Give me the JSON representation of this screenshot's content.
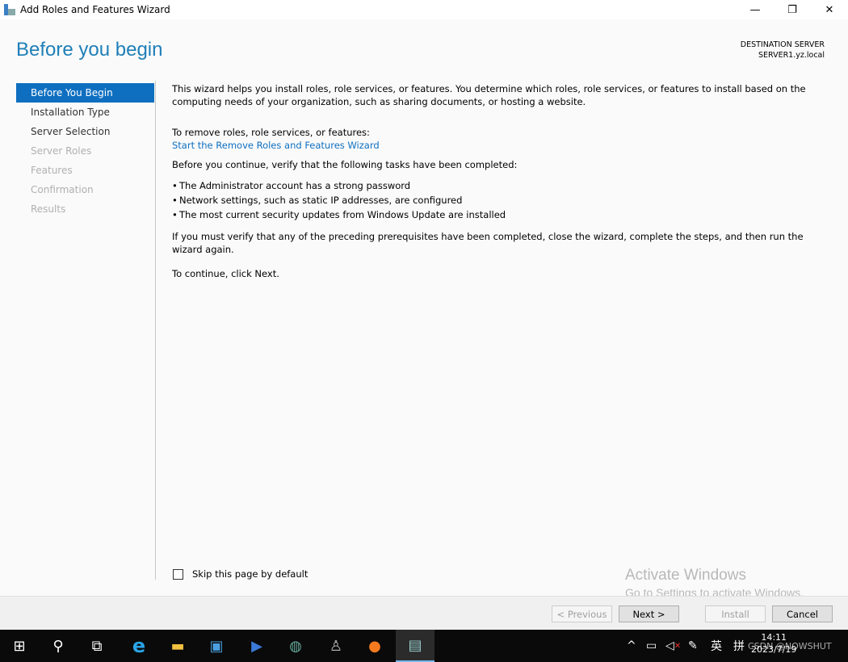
{
  "window": {
    "title": "Add Roles and Features Wizard",
    "minimize": "—",
    "maximize": "❐",
    "close": "✕"
  },
  "header": {
    "title": "Before you begin",
    "dest_label": "DESTINATION SERVER",
    "dest_server": "SERVER1.yz.local"
  },
  "sidebar": {
    "items": [
      {
        "label": "Before You Begin",
        "state": "active"
      },
      {
        "label": "Installation Type",
        "state": "enabled"
      },
      {
        "label": "Server Selection",
        "state": "enabled"
      },
      {
        "label": "Server Roles",
        "state": "disabled"
      },
      {
        "label": "Features",
        "state": "disabled"
      },
      {
        "label": "Confirmation",
        "state": "disabled"
      },
      {
        "label": "Results",
        "state": "disabled"
      }
    ]
  },
  "content": {
    "intro": "This wizard helps you install roles, role services, or features. You determine which roles, role services, or features to install based on the computing needs of your organization, such as sharing documents, or hosting a website.",
    "remove_label": "To remove roles, role services, or features:",
    "remove_link": "Start the Remove Roles and Features Wizard",
    "verify": "Before you continue, verify that the following tasks have been completed:",
    "bullets": [
      "The Administrator account has a strong password",
      "Network settings, such as static IP addresses, are configured",
      "The most current security updates from Windows Update are installed"
    ],
    "prereq": "If you must verify that any of the preceding prerequisites have been completed, close the wizard, complete the steps, and then run the wizard again.",
    "continue": "To continue, click Next."
  },
  "skip": {
    "label": "Skip this page by default",
    "checked": false
  },
  "watermark": {
    "line1": "Activate Windows",
    "line2": "Go to Settings to activate Windows."
  },
  "buttons": {
    "previous": "< Previous",
    "next": "Next >",
    "install": "Install",
    "cancel": "Cancel"
  },
  "taskbar": {
    "tray_ime": "英",
    "tray_ime2": "拼",
    "time": "14:11",
    "date": "2023/7/19",
    "overlay": "CSDN @NOWSHUT"
  },
  "colors": {
    "accent": "#0e6fc0",
    "title": "#1e7fb8"
  }
}
